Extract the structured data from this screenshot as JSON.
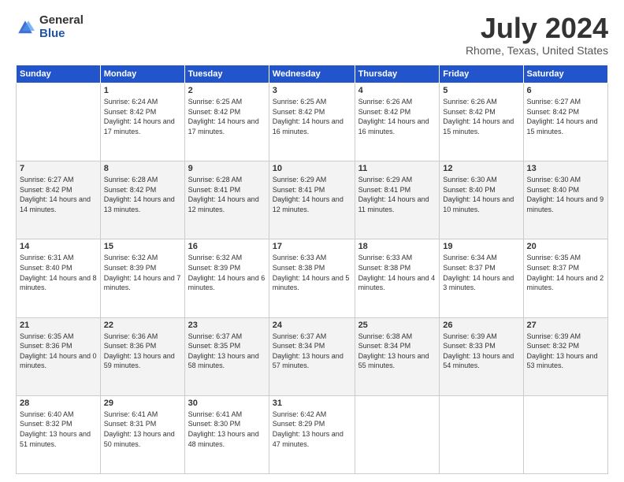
{
  "logo": {
    "general": "General",
    "blue": "Blue"
  },
  "title": "July 2024",
  "location": "Rhome, Texas, United States",
  "days_of_week": [
    "Sunday",
    "Monday",
    "Tuesday",
    "Wednesday",
    "Thursday",
    "Friday",
    "Saturday"
  ],
  "weeks": [
    [
      {
        "day": "",
        "info": ""
      },
      {
        "day": "1",
        "info": "Sunrise: 6:24 AM\nSunset: 8:42 PM\nDaylight: 14 hours and 17 minutes."
      },
      {
        "day": "2",
        "info": "Sunrise: 6:25 AM\nSunset: 8:42 PM\nDaylight: 14 hours and 17 minutes."
      },
      {
        "day": "3",
        "info": "Sunrise: 6:25 AM\nSunset: 8:42 PM\nDaylight: 14 hours and 16 minutes."
      },
      {
        "day": "4",
        "info": "Sunrise: 6:26 AM\nSunset: 8:42 PM\nDaylight: 14 hours and 16 minutes."
      },
      {
        "day": "5",
        "info": "Sunrise: 6:26 AM\nSunset: 8:42 PM\nDaylight: 14 hours and 15 minutes."
      },
      {
        "day": "6",
        "info": "Sunrise: 6:27 AM\nSunset: 8:42 PM\nDaylight: 14 hours and 15 minutes."
      }
    ],
    [
      {
        "day": "7",
        "info": "Sunrise: 6:27 AM\nSunset: 8:42 PM\nDaylight: 14 hours and 14 minutes."
      },
      {
        "day": "8",
        "info": "Sunrise: 6:28 AM\nSunset: 8:42 PM\nDaylight: 14 hours and 13 minutes."
      },
      {
        "day": "9",
        "info": "Sunrise: 6:28 AM\nSunset: 8:41 PM\nDaylight: 14 hours and 12 minutes."
      },
      {
        "day": "10",
        "info": "Sunrise: 6:29 AM\nSunset: 8:41 PM\nDaylight: 14 hours and 12 minutes."
      },
      {
        "day": "11",
        "info": "Sunrise: 6:29 AM\nSunset: 8:41 PM\nDaylight: 14 hours and 11 minutes."
      },
      {
        "day": "12",
        "info": "Sunrise: 6:30 AM\nSunset: 8:40 PM\nDaylight: 14 hours and 10 minutes."
      },
      {
        "day": "13",
        "info": "Sunrise: 6:30 AM\nSunset: 8:40 PM\nDaylight: 14 hours and 9 minutes."
      }
    ],
    [
      {
        "day": "14",
        "info": "Sunrise: 6:31 AM\nSunset: 8:40 PM\nDaylight: 14 hours and 8 minutes."
      },
      {
        "day": "15",
        "info": "Sunrise: 6:32 AM\nSunset: 8:39 PM\nDaylight: 14 hours and 7 minutes."
      },
      {
        "day": "16",
        "info": "Sunrise: 6:32 AM\nSunset: 8:39 PM\nDaylight: 14 hours and 6 minutes."
      },
      {
        "day": "17",
        "info": "Sunrise: 6:33 AM\nSunset: 8:38 PM\nDaylight: 14 hours and 5 minutes."
      },
      {
        "day": "18",
        "info": "Sunrise: 6:33 AM\nSunset: 8:38 PM\nDaylight: 14 hours and 4 minutes."
      },
      {
        "day": "19",
        "info": "Sunrise: 6:34 AM\nSunset: 8:37 PM\nDaylight: 14 hours and 3 minutes."
      },
      {
        "day": "20",
        "info": "Sunrise: 6:35 AM\nSunset: 8:37 PM\nDaylight: 14 hours and 2 minutes."
      }
    ],
    [
      {
        "day": "21",
        "info": "Sunrise: 6:35 AM\nSunset: 8:36 PM\nDaylight: 14 hours and 0 minutes."
      },
      {
        "day": "22",
        "info": "Sunrise: 6:36 AM\nSunset: 8:36 PM\nDaylight: 13 hours and 59 minutes."
      },
      {
        "day": "23",
        "info": "Sunrise: 6:37 AM\nSunset: 8:35 PM\nDaylight: 13 hours and 58 minutes."
      },
      {
        "day": "24",
        "info": "Sunrise: 6:37 AM\nSunset: 8:34 PM\nDaylight: 13 hours and 57 minutes."
      },
      {
        "day": "25",
        "info": "Sunrise: 6:38 AM\nSunset: 8:34 PM\nDaylight: 13 hours and 55 minutes."
      },
      {
        "day": "26",
        "info": "Sunrise: 6:39 AM\nSunset: 8:33 PM\nDaylight: 13 hours and 54 minutes."
      },
      {
        "day": "27",
        "info": "Sunrise: 6:39 AM\nSunset: 8:32 PM\nDaylight: 13 hours and 53 minutes."
      }
    ],
    [
      {
        "day": "28",
        "info": "Sunrise: 6:40 AM\nSunset: 8:32 PM\nDaylight: 13 hours and 51 minutes."
      },
      {
        "day": "29",
        "info": "Sunrise: 6:41 AM\nSunset: 8:31 PM\nDaylight: 13 hours and 50 minutes."
      },
      {
        "day": "30",
        "info": "Sunrise: 6:41 AM\nSunset: 8:30 PM\nDaylight: 13 hours and 48 minutes."
      },
      {
        "day": "31",
        "info": "Sunrise: 6:42 AM\nSunset: 8:29 PM\nDaylight: 13 hours and 47 minutes."
      },
      {
        "day": "",
        "info": ""
      },
      {
        "day": "",
        "info": ""
      },
      {
        "day": "",
        "info": ""
      }
    ]
  ]
}
